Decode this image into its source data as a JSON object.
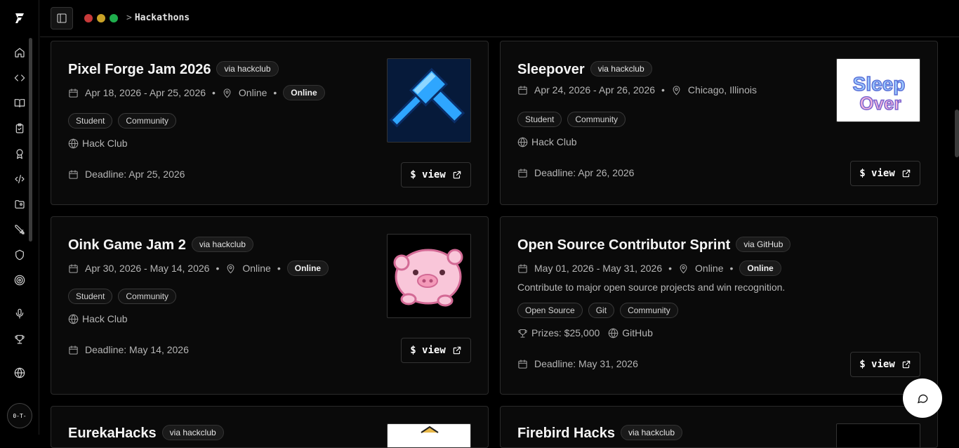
{
  "breadcrumb": {
    "separator": ">",
    "current": "Hackathons"
  },
  "avatar_text": "0-T-",
  "colors": {
    "dot_red": "#c73a3a",
    "dot_yellow": "#c9a227",
    "dot_green": "#1fae4d"
  },
  "view_label": "$ view",
  "cards": [
    {
      "title": "Pixel Forge Jam 2026",
      "via": "via hackclub",
      "dates": "Apr 18, 2026 - Apr 25, 2026",
      "location": "Online",
      "mode": "Online",
      "tags": [
        "Student",
        "Community"
      ],
      "org": "Hack Club",
      "deadline": "Deadline: Apr 25, 2026"
    },
    {
      "title": "Sleepover",
      "via": "via hackclub",
      "dates": "Apr 24, 2026 - Apr 26, 2026",
      "location": "Chicago, Illinois",
      "tags": [
        "Student",
        "Community"
      ],
      "org": "Hack Club",
      "deadline": "Deadline: Apr 26, 2026",
      "logo_text": "Sleep Over"
    },
    {
      "title": "Oink Game Jam 2",
      "via": "via hackclub",
      "dates": "Apr 30, 2026 - May 14, 2026",
      "location": "Online",
      "mode": "Online",
      "tags": [
        "Student",
        "Community"
      ],
      "org": "Hack Club",
      "deadline": "Deadline: May 14, 2026"
    },
    {
      "title": "Open Source Contributor Sprint",
      "via": "via GitHub",
      "dates": "May 01, 2026 - May 31, 2026",
      "location": "Online",
      "mode": "Online",
      "description": "Contribute to major open source projects and win recognition.",
      "tags": [
        "Open Source",
        "Git",
        "Community"
      ],
      "prizes": "Prizes: $25,000",
      "org": "GitHub",
      "deadline": "Deadline: May 31, 2026"
    },
    {
      "title": "EurekaHacks",
      "via": "via hackclub"
    },
    {
      "title": "Firebird Hacks",
      "via": "via hackclub"
    }
  ]
}
